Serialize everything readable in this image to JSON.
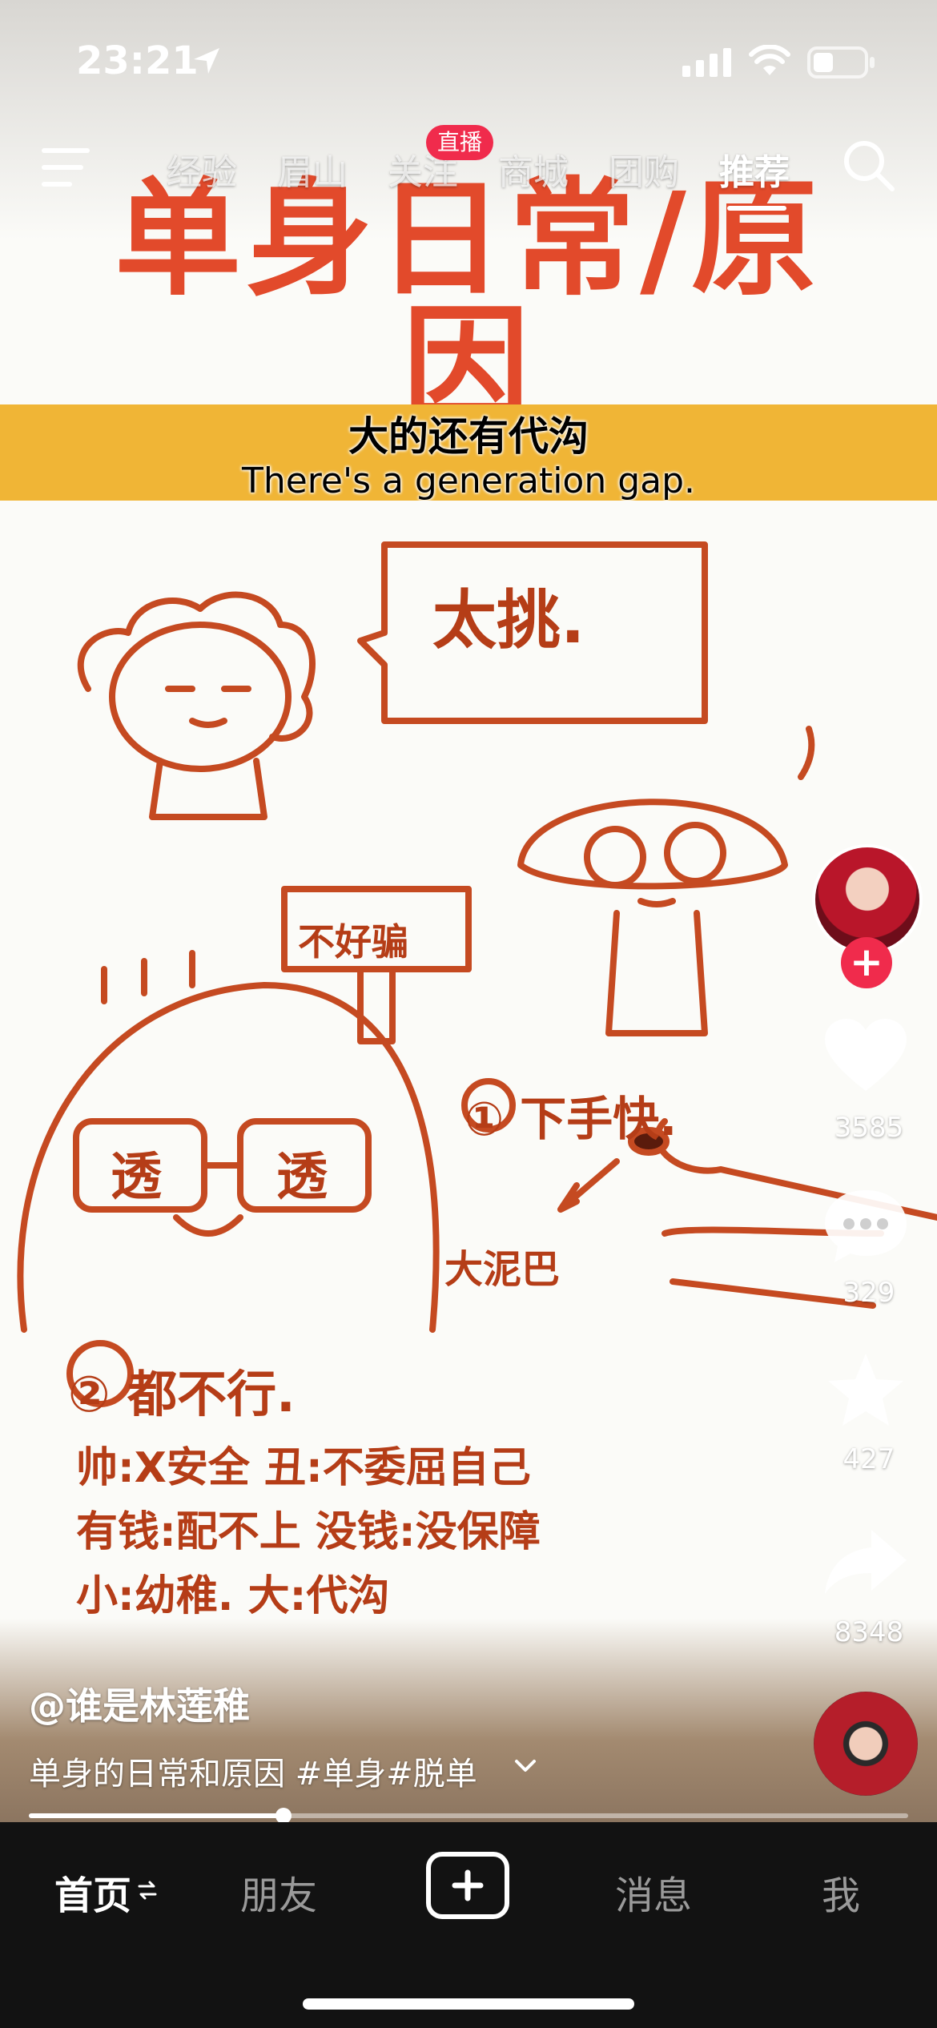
{
  "status_bar": {
    "time": "23:21"
  },
  "nav": {
    "items": [
      "经验",
      "眉山",
      "关注",
      "商城",
      "团购",
      "推荐"
    ],
    "active": "推荐",
    "live_badge": "直播"
  },
  "video": {
    "title_art": "单身日常/原因",
    "subtitle_zh": "大的还有代沟",
    "subtitle_en": "There's a generation gap.",
    "sketch_text": {
      "bubble": "太挑.",
      "sign": "不好骗",
      "glasses_left": "透",
      "glasses_right": "透",
      "point1": "① 下手快.",
      "dirt_label": "大泥巴",
      "point2": "② 都不行.",
      "line1": "帅:X安全  丑:不委屈自己",
      "line2": "有钱:配不上  没钱:没保障",
      "line3": "小:幼稚.  大:代沟"
    }
  },
  "rail": {
    "likes": "3585",
    "comments": "329",
    "favorites": "427",
    "shares": "8348"
  },
  "caption": {
    "author": "@谁是林莲稚",
    "description": "单身的日常和原因 #单身#脱单"
  },
  "progress": {
    "fraction": 0.29
  },
  "tabbar": {
    "home": "首页",
    "friends": "朋友",
    "messages": "消息",
    "me": "我"
  },
  "colors": {
    "accent": "#f02b4c",
    "sketch": "#c54a21",
    "band": "#f0b536"
  }
}
